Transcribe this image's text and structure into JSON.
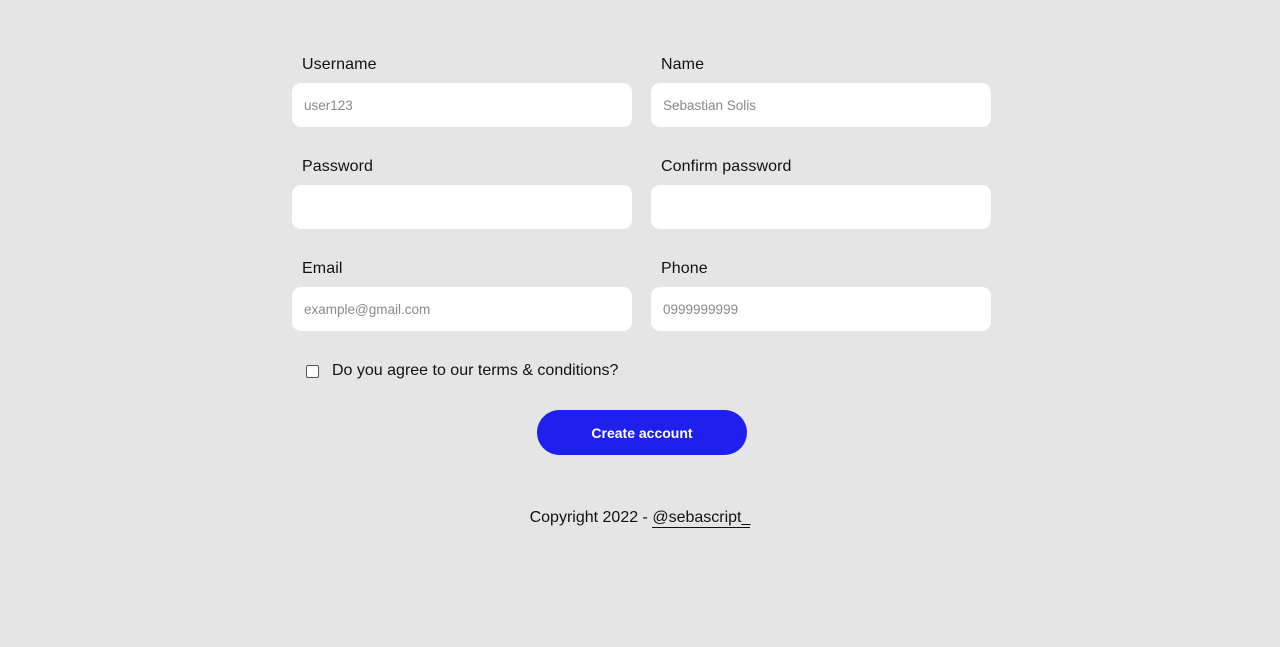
{
  "form": {
    "username": {
      "label": "Username",
      "placeholder": "user123",
      "value": ""
    },
    "name": {
      "label": "Name",
      "placeholder": "Sebastian Solis",
      "value": ""
    },
    "password": {
      "label": "Password",
      "placeholder": "",
      "value": ""
    },
    "confirm_password": {
      "label": "Confirm password",
      "placeholder": "",
      "value": ""
    },
    "email": {
      "label": "Email",
      "placeholder": "example@gmail.com",
      "value": ""
    },
    "phone": {
      "label": "Phone",
      "placeholder": "0999999999",
      "value": ""
    },
    "terms": {
      "label": "Do you agree to our terms & conditions?",
      "checked": false
    },
    "submit_label": "Create account"
  },
  "footer": {
    "copyright_text": "Copyright 2022 - ",
    "link_text": "@sebascript_"
  },
  "colors": {
    "background": "#e5e5e5",
    "input_background": "#ffffff",
    "button": "#2020ee",
    "button_text": "#ffffff",
    "text": "#111111"
  }
}
